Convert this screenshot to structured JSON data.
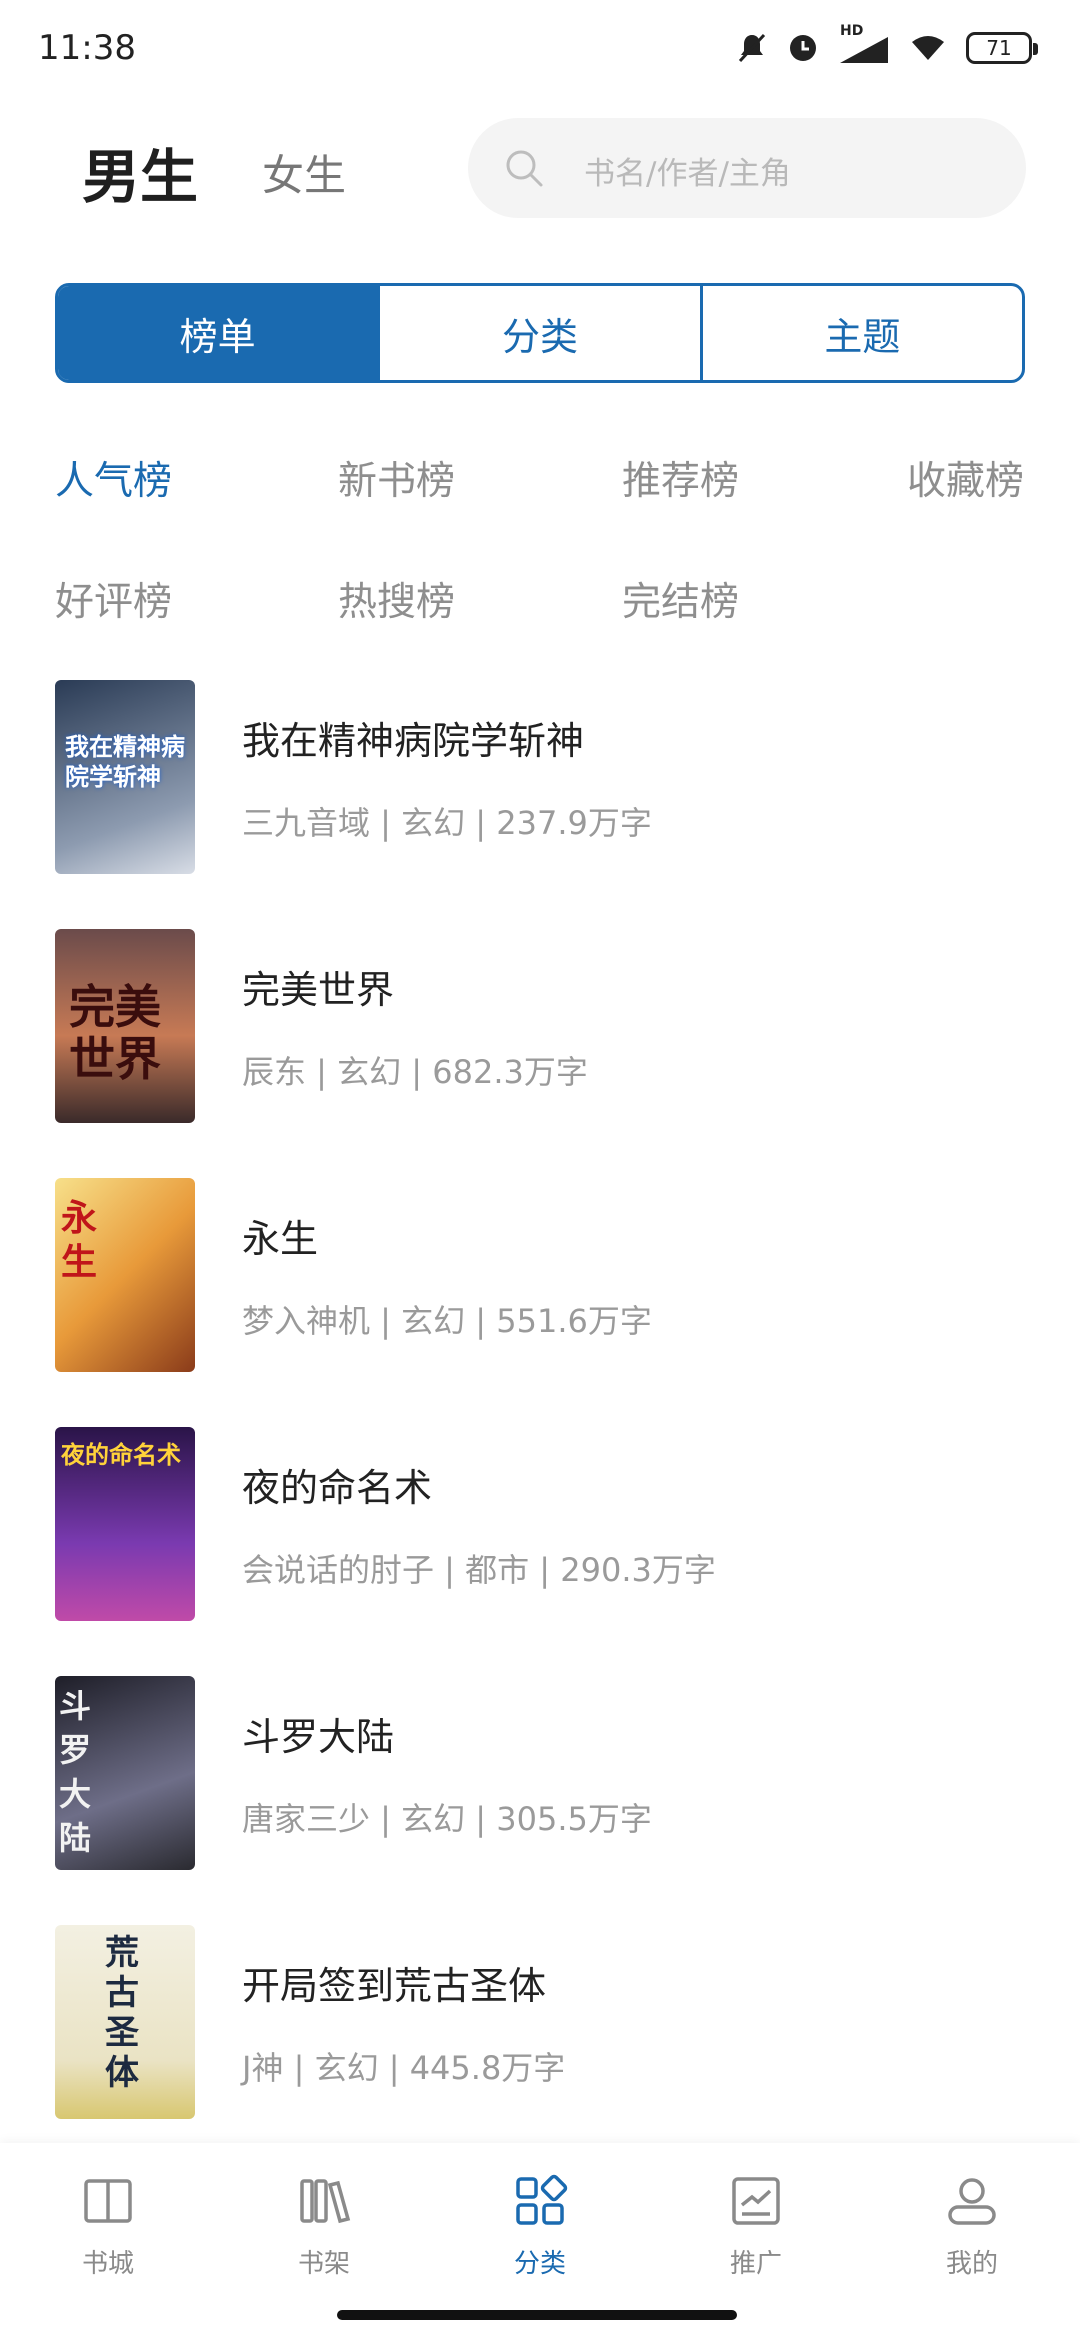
{
  "status_bar": {
    "time": "11:38",
    "battery": "71",
    "network": "HD"
  },
  "header": {
    "gender_tabs": [
      {
        "label": "男生",
        "active": true
      },
      {
        "label": "女生",
        "active": false
      }
    ],
    "search_placeholder": "书名/作者/主角"
  },
  "segments": [
    {
      "label": "榜单",
      "active": true
    },
    {
      "label": "分类",
      "active": false
    },
    {
      "label": "主题",
      "active": false
    }
  ],
  "rank_tabs": [
    {
      "label": "人气榜",
      "active": true
    },
    {
      "label": "新书榜",
      "active": false
    },
    {
      "label": "推荐榜",
      "active": false
    },
    {
      "label": "收藏榜",
      "active": false
    },
    {
      "label": "好评榜",
      "active": false
    },
    {
      "label": "热搜榜",
      "active": false
    },
    {
      "label": "完结榜",
      "active": false
    }
  ],
  "books": [
    {
      "title": "我在精神病院学斩神",
      "meta": "三九音域 | 玄幻 | 237.9万字",
      "cover_text": "我在精神病院学斩神",
      "cover_colors": [
        "#2a3b55",
        "#8d9bb0"
      ]
    },
    {
      "title": "完美世界",
      "meta": "辰东 | 玄幻 | 682.3万字",
      "cover_text": "完美世界",
      "cover_colors": [
        "#4a2a2a",
        "#c77a55"
      ]
    },
    {
      "title": "永生",
      "meta": "梦入神机 | 玄幻 | 551.6万字",
      "cover_text": "永生",
      "cover_colors": [
        "#8a3b1a",
        "#f2c25a"
      ]
    },
    {
      "title": "夜的命名术",
      "meta": "会说话的肘子 | 都市 | 290.3万字",
      "cover_text": "夜的命名术",
      "cover_colors": [
        "#2a1448",
        "#7a3ab0"
      ]
    },
    {
      "title": "斗罗大陆",
      "meta": "唐家三少 | 玄幻 | 305.5万字",
      "cover_text": "斗罗大陆",
      "cover_colors": [
        "#1e1e28",
        "#6e6e88"
      ]
    },
    {
      "title": "开局签到荒古圣体",
      "meta": "J神 | 玄幻 | 445.8万字",
      "cover_text": "荒古圣体",
      "cover_colors": [
        "#f3f0e2",
        "#d8c770"
      ]
    }
  ],
  "bottom_nav": [
    {
      "label": "书城",
      "icon": "book-open-icon",
      "active": false
    },
    {
      "label": "书架",
      "icon": "bookshelf-icon",
      "active": false
    },
    {
      "label": "分类",
      "icon": "category-grid-icon",
      "active": true
    },
    {
      "label": "推广",
      "icon": "promotion-chart-icon",
      "active": false
    },
    {
      "label": "我的",
      "icon": "profile-icon",
      "active": false
    }
  ],
  "colors": {
    "accent": "#1a6ab0",
    "muted": "#8e8e8e"
  }
}
